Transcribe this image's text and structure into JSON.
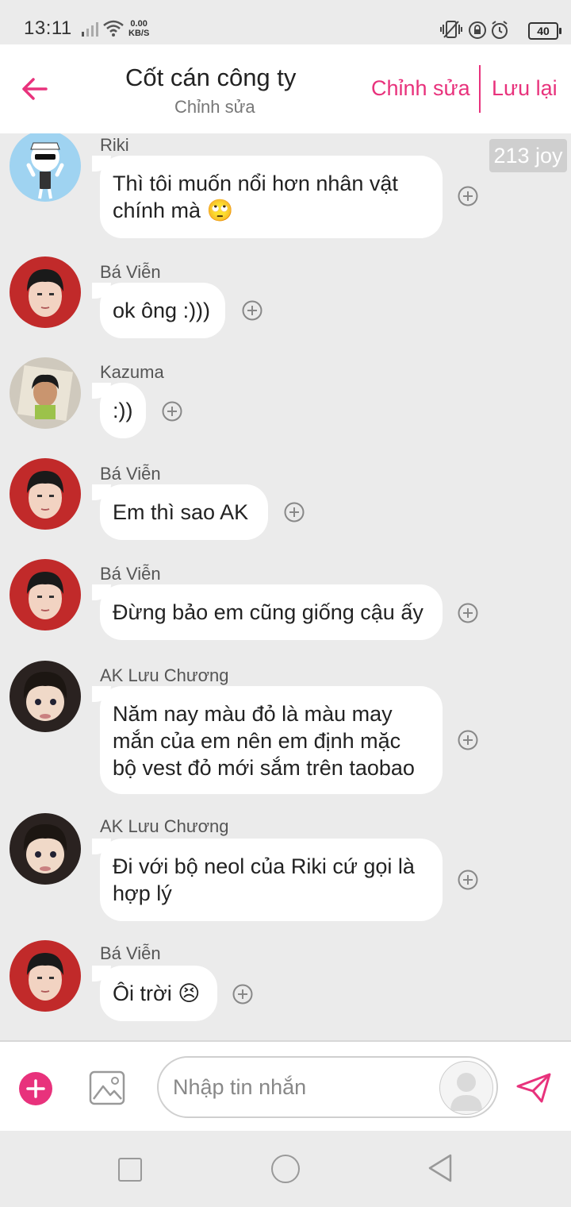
{
  "status_bar": {
    "time": "13:11",
    "speed_value": "0.00",
    "speed_unit": "KB/S",
    "battery": "40"
  },
  "header": {
    "title": "Cốt cán công ty",
    "subtitle": "Chỉnh sửa",
    "edit_label": "Chỉnh sửa",
    "save_label": "Lưu lại"
  },
  "badge": "213 joy",
  "messages": [
    {
      "sender": "Riki",
      "lines": [
        "Thì tôi muốn nổi hơn nhân vật",
        "chính mà 🙄"
      ]
    },
    {
      "sender": "Bá Viễn",
      "lines": [
        "ok ông :)))"
      ]
    },
    {
      "sender": "Kazuma",
      "lines": [
        ":))"
      ]
    },
    {
      "sender": "Bá Viễn",
      "lines": [
        "Em thì sao AK"
      ]
    },
    {
      "sender": "Bá Viễn",
      "lines": [
        "Đừng bảo em cũng giống cậu ấy"
      ]
    },
    {
      "sender": "AK Lưu Chương",
      "lines": [
        "Năm nay màu đỏ là màu may",
        "mắn của em nên em định mặc",
        "bộ vest đỏ mới sắm trên taobao"
      ]
    },
    {
      "sender": "AK Lưu Chương",
      "lines": [
        "Đi với bộ neol của Riki cứ gọi là",
        "hợp lý"
      ]
    },
    {
      "sender": "Bá Viễn",
      "lines": [
        "Ôi trời 😣"
      ]
    }
  ],
  "composer": {
    "placeholder": "Nhập tin nhắn"
  },
  "colors": {
    "accent": "#e8327c",
    "background": "#ebebeb",
    "bubble": "#ffffff"
  }
}
